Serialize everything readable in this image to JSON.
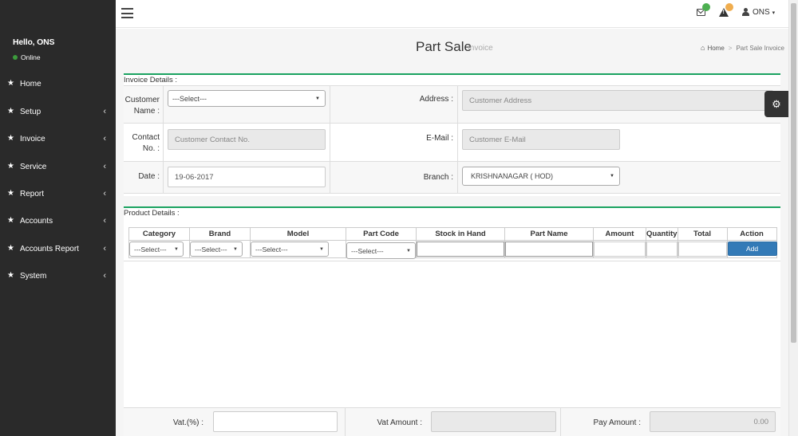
{
  "sidebar": {
    "greeting": "Hello, ONS",
    "status": "Online",
    "items": [
      {
        "label": "Home",
        "has_submenu": false
      },
      {
        "label": "Setup",
        "has_submenu": true
      },
      {
        "label": "Invoice",
        "has_submenu": true
      },
      {
        "label": "Service",
        "has_submenu": true
      },
      {
        "label": "Report",
        "has_submenu": true
      },
      {
        "label": "Accounts",
        "has_submenu": true
      },
      {
        "label": "Accounts Report",
        "has_submenu": true
      },
      {
        "label": "System",
        "has_submenu": true
      }
    ],
    "chevron": "‹"
  },
  "header": {
    "user": "ONS",
    "user_caret": "▾"
  },
  "page": {
    "title": "Part Sale",
    "subtitle": "Invoice",
    "breadcrumb_home": "Home",
    "breadcrumb_sep": ">",
    "breadcrumb_current": "Part Sale Invoice"
  },
  "invoice": {
    "section_title": "Invoice Details :",
    "customer_label": "Customer Name :",
    "customer_select": "---Select---",
    "address_label": "Address :",
    "address_placeholder": "Customer Address",
    "contact_label": "Contact No. :",
    "contact_placeholder": "Customer Contact No.",
    "email_label": "E-Mail :",
    "email_placeholder": "Customer E-Mail",
    "date_label": "Date :",
    "date_value": "19-06-2017",
    "branch_label": "Branch :",
    "branch_value": "KRISHNANAGAR ( HOD)"
  },
  "product": {
    "section_title": "Product Details :",
    "columns": [
      "Category",
      "Brand",
      "Model",
      "Part Code",
      "Stock in Hand",
      "Part Name",
      "Amount",
      "Quantity",
      "Total",
      "Action"
    ],
    "category_select": "---Select---",
    "brand_select": "---Select---",
    "model_select": "---Select---",
    "partcode_select": "---Select---",
    "add_label": "Add"
  },
  "totals": {
    "vat_label": "Vat.(%) :",
    "vat_amount_label": "Vat Amount :",
    "pay_amount_label": "Pay Amount :",
    "pay_amount_value": "0.00"
  },
  "icons": {
    "menu": "hamburger-icon",
    "mail": "envelope-icon",
    "alert": "warning-icon",
    "user": "user-icon",
    "settings": "gear-icon",
    "home": "home-icon"
  },
  "colors": {
    "sidebar_bg": "#2a2a2a",
    "accent_border": "#1aa260",
    "primary_button": "#337ab7",
    "online_dot": "#3c9b3c",
    "mail_badge": "#4caf50",
    "alert_badge": "#f0ad4e"
  }
}
